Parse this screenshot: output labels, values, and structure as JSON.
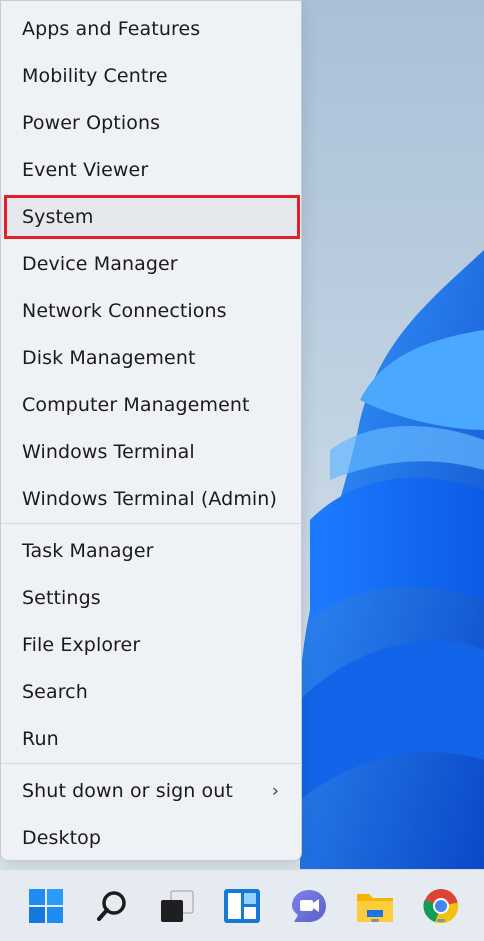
{
  "context_menu": {
    "items_group1": [
      {
        "label": "Apps and Features"
      },
      {
        "label": "Mobility Centre"
      },
      {
        "label": "Power Options"
      },
      {
        "label": "Event Viewer"
      },
      {
        "label": "System"
      },
      {
        "label": "Device Manager"
      },
      {
        "label": "Network Connections"
      },
      {
        "label": "Disk Management"
      },
      {
        "label": "Computer Management"
      },
      {
        "label": "Windows Terminal"
      },
      {
        "label": "Windows Terminal (Admin)"
      }
    ],
    "items_group2": [
      {
        "label": "Task Manager"
      },
      {
        "label": "Settings"
      },
      {
        "label": "File Explorer"
      },
      {
        "label": "Search"
      },
      {
        "label": "Run"
      }
    ],
    "items_group3": [
      {
        "label": "Shut down or sign out"
      },
      {
        "label": "Desktop"
      }
    ],
    "highlighted_item": "System",
    "submenu_chevron": "›"
  },
  "taskbar": {
    "icons": [
      "windows-start-icon",
      "search-icon",
      "task-view-icon",
      "widgets-icon",
      "teams-chat-icon",
      "file-explorer-icon",
      "chrome-icon"
    ]
  },
  "colors": {
    "highlight_border": "#e2202a",
    "menu_bg": "#eef1f5",
    "accent_blue": "#1e6fe0"
  }
}
